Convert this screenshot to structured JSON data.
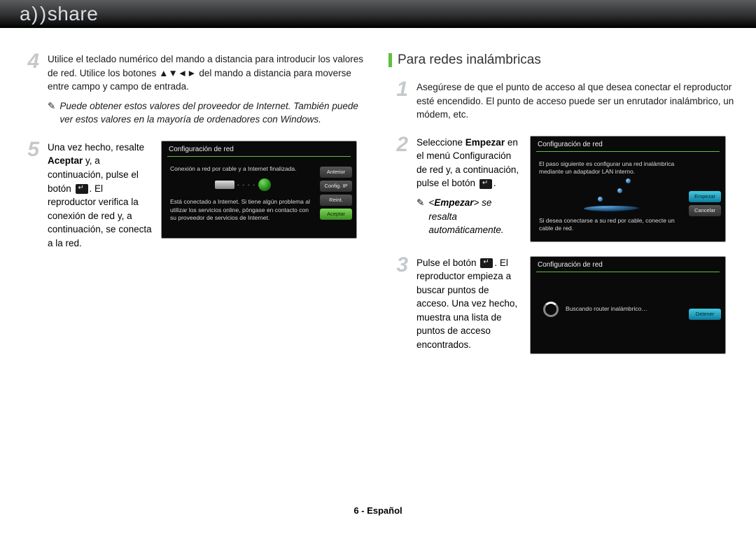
{
  "brand": {
    "logo_a": "a",
    "logo_share": "share"
  },
  "left": {
    "step4": {
      "num": "4",
      "text_before": "Utilice el teclado numérico del mando a distancia para introducir los valores de red. Utilice los botones ",
      "arrows": "▲▼◄►",
      "text_after": " del mando a distancia para moverse entre campo y campo de entrada.",
      "note": "Puede obtener estos valores del proveedor de Internet. También puede ver estos valores en la mayoría de ordenadores con Windows."
    },
    "step5": {
      "num": "5",
      "text_a": "Una vez hecho, resalte ",
      "bold": "Aceptar",
      "text_b": " y, a continuación, pulse el botón ",
      "text_c": ". El reproductor verifica la conexión de red y, a continuación, se conecta a la red.",
      "shot": {
        "title": "Configuración de red",
        "line1": "Conexión a red por cable y a Internet finalizada.",
        "footer_msg": "Está conectado a Internet. Si tiene algún problema al utilizar los servicios online, póngase en contacto con su proveedor de servicios de Internet.",
        "btn_prev": "Anterior",
        "btn_ip": "Config. IP",
        "btn_reset": "Reint.",
        "btn_ok": "Aceptar"
      }
    }
  },
  "right": {
    "heading": "Para redes inalámbricas",
    "step1": {
      "num": "1",
      "text": "Asegúrese de que el punto de acceso al que desea conectar el reproductor esté encendido. El punto de acceso puede ser un enrutador inalámbrico, un módem, etc."
    },
    "step2": {
      "num": "2",
      "text_a": "Seleccione ",
      "bold": "Empezar",
      "text_b": " en el menú Configuración de red y, a continuación, pulse el botón ",
      "text_c": ".",
      "note_a": "<",
      "note_bold": "Empezar",
      "note_b": "> se resalta automáticamente.",
      "shot": {
        "title": "Configuración de red",
        "line1": "El paso siguiente es configurar una red inalámbrica mediante un adaptador LAN interno.",
        "line2": "Si desea conectarse a su red por cable, conecte un cable de red.",
        "btn_start": "Empezar",
        "btn_cancel": "Cancelar"
      }
    },
    "step3": {
      "num": "3",
      "text_a": "Pulse el botón ",
      "text_b": ". El reproductor empieza a buscar puntos de acceso. Una vez hecho, muestra una lista de puntos de acceso encontrados.",
      "shot": {
        "title": "Configuración de red",
        "searching": "Buscando router inalámbrico…",
        "btn_stop": "Detener"
      }
    }
  },
  "footer": "6 - Español"
}
